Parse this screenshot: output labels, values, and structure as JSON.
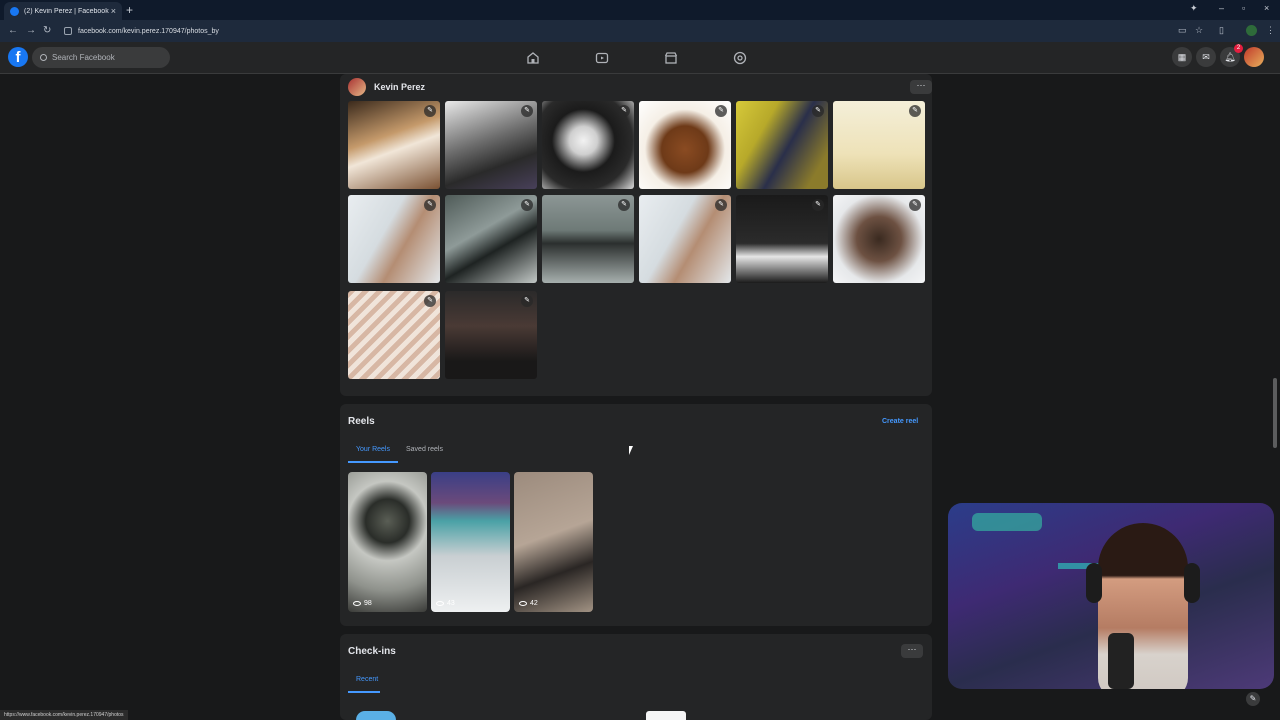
{
  "browser": {
    "tab_title": "(2) Kevin Perez | Facebook",
    "url": "facebook.com/kevin.perez.170947/photos_by",
    "status_url": "https://www.facebook.com/kevin.perez.170947/photos"
  },
  "facebook": {
    "search_placeholder": "Search Facebook",
    "notification_count": "2"
  },
  "profile": {
    "name": "Kevin Perez"
  },
  "reels": {
    "title": "Reels",
    "create_label": "Create reel",
    "tabs": [
      {
        "label": "Your Reels",
        "active": true
      },
      {
        "label": "Saved reels",
        "active": false
      }
    ],
    "items": [
      {
        "views": "98"
      },
      {
        "views": "43"
      },
      {
        "views": "42"
      }
    ]
  },
  "checkins": {
    "title": "Check-ins",
    "tabs": [
      {
        "label": "Recent",
        "active": true
      }
    ]
  },
  "colors": {
    "accent": "#4599ff",
    "brand": "#1877f2",
    "background": "#18191a",
    "card": "#242526"
  }
}
